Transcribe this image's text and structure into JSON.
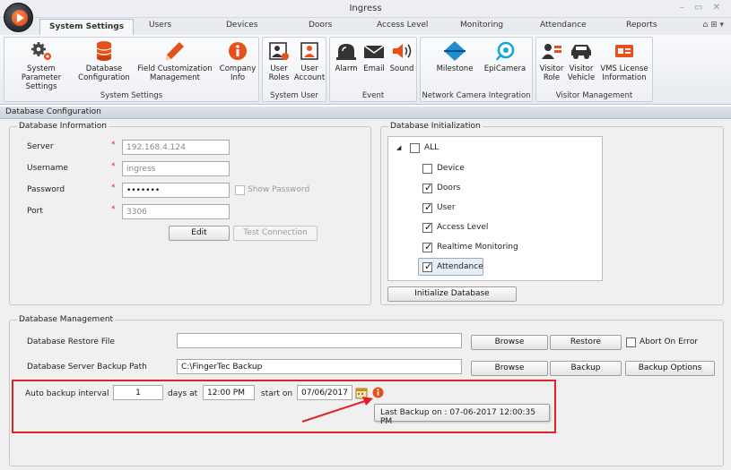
{
  "window": {
    "title": "Ingress",
    "controls": "–  ▭  ✕"
  },
  "tabs": [
    {
      "label": "System Settings",
      "active": true
    },
    {
      "label": "Users"
    },
    {
      "label": "Devices"
    },
    {
      "label": "Doors"
    },
    {
      "label": "Access Level"
    },
    {
      "label": "Monitoring"
    },
    {
      "label": "Attendance"
    },
    {
      "label": "Reports"
    }
  ],
  "tab_right": "⌂ ⊞ ▾",
  "ribbon": {
    "groups": [
      {
        "title": "System Settings",
        "buttons": [
          {
            "label1": "System Parameter",
            "label2": "Settings",
            "icon": "gears-icon"
          },
          {
            "label1": "Database",
            "label2": "Configuration",
            "icon": "database-icon"
          },
          {
            "label1": "Field Customization",
            "label2": "Management",
            "icon": "pencil-icon"
          },
          {
            "label1": "Company",
            "label2": "Info",
            "icon": "info-icon"
          }
        ]
      },
      {
        "title": "System User",
        "buttons": [
          {
            "label1": "User",
            "label2": "Roles",
            "icon": "user-roles-icon"
          },
          {
            "label1": "User",
            "label2": "Account",
            "icon": "user-account-icon"
          }
        ]
      },
      {
        "title": "Event",
        "buttons": [
          {
            "label1": "Alarm",
            "label2": "",
            "icon": "alarm-icon"
          },
          {
            "label1": "Email",
            "label2": "",
            "icon": "email-icon"
          },
          {
            "label1": "Sound",
            "label2": "",
            "icon": "sound-icon"
          }
        ]
      },
      {
        "title": "Network Camera Integration",
        "buttons": [
          {
            "label1": "Milestone",
            "label2": "",
            "icon": "milestone-icon"
          },
          {
            "label1": "EpiCamera",
            "label2": "",
            "icon": "camera-icon"
          }
        ]
      },
      {
        "title": "Visitor Management",
        "buttons": [
          {
            "label1": "Visitor",
            "label2": "Role",
            "icon": "visitor-role-icon"
          },
          {
            "label1": "Visitor",
            "label2": "Vehicle",
            "icon": "car-icon"
          },
          {
            "label1": "VMS License",
            "label2": "Information",
            "icon": "license-icon"
          }
        ]
      }
    ]
  },
  "panel_title": "Database Configuration",
  "db_info": {
    "legend": "Database Information",
    "server_label": "Server",
    "server_value": "192.168.4.124",
    "username_label": "Username",
    "username_value": "ingress",
    "password_label": "Password",
    "password_value": "•••••••",
    "show_password": "Show Password",
    "port_label": "Port",
    "port_value": "3306",
    "required_mark": "*",
    "edit_button": "Edit",
    "test_button": "Test Connection"
  },
  "db_init": {
    "legend": "Database Initialization",
    "expander": "◢",
    "all_label": "ALL",
    "items": [
      {
        "label": "Device",
        "checked": false
      },
      {
        "label": "Doors",
        "checked": true
      },
      {
        "label": "User",
        "checked": true
      },
      {
        "label": "Access Level",
        "checked": true
      },
      {
        "label": "Realtime Monitoring",
        "checked": true
      },
      {
        "label": "Attendance",
        "checked": true
      }
    ],
    "init_button": "Initialize Database"
  },
  "db_mgmt": {
    "legend": "Database Management",
    "restore_label": "Database Restore File",
    "restore_value": "",
    "browse1": "Browse",
    "restore_button": "Restore",
    "abort_label": "Abort On Error",
    "backup_path_label": "Database Server Backup Path",
    "backup_path_value": "C:\\FingerTec Backup",
    "browse2": "Browse",
    "backup_button": "Backup",
    "backup_options_button": "Backup Options",
    "auto_label": "Auto backup interval",
    "interval_value": "1",
    "days_at_label": "days at",
    "time_value": "12:00 PM",
    "start_on_label": "start on",
    "date_value": "07/06/2017",
    "tooltip": "Last Backup on : 07-06-2017 12:00:35 PM"
  },
  "colors": {
    "accent_red": "#e0212a",
    "info_orange": "#e8501a"
  }
}
